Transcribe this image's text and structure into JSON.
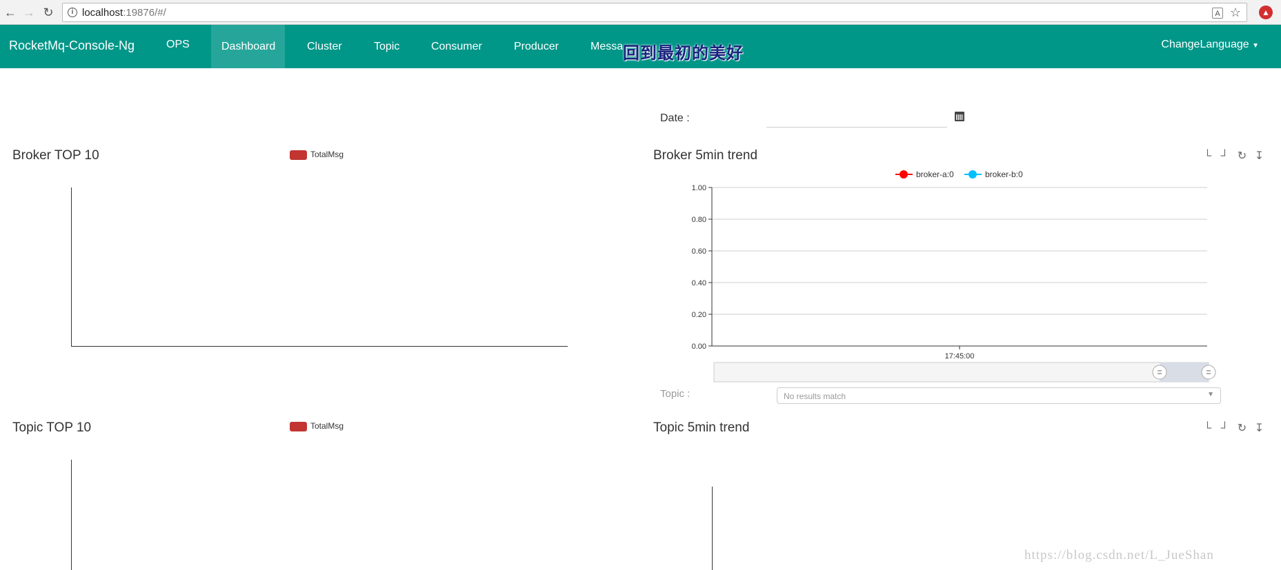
{
  "browser": {
    "url_host": "localhost",
    "url_rest": ":19876/#/"
  },
  "navbar": {
    "brand": "RocketMq-Console-Ng",
    "items": [
      {
        "label": "OPS"
      },
      {
        "label": "Dashboard"
      },
      {
        "label": "Cluster"
      },
      {
        "label": "Topic"
      },
      {
        "label": "Consumer"
      },
      {
        "label": "Producer"
      },
      {
        "label": "Messa"
      }
    ],
    "overlay_text": "回到最初的美好",
    "change_language": "ChangeLanguage"
  },
  "date": {
    "label": "Date :",
    "value": ""
  },
  "broker_top10": {
    "title": "Broker TOP 10",
    "legend": "TotalMsg"
  },
  "broker_trend": {
    "title": "Broker 5min trend",
    "legend": [
      {
        "name": "broker-a:0",
        "color": "#ff0000"
      },
      {
        "name": "broker-b:0",
        "color": "#00bfff"
      }
    ]
  },
  "topic_filter": {
    "label": "Topic :",
    "placeholder": "No results match"
  },
  "topic_top10": {
    "title": "Topic TOP 10",
    "legend": "TotalMsg"
  },
  "topic_trend": {
    "title": "Topic 5min trend"
  },
  "toolbox_icons": [
    "zoom-icon",
    "zoom-reset-icon",
    "restore-icon",
    "save-image-icon"
  ],
  "watermark": "https://blog.csdn.net/L_JueShan",
  "chart_data": [
    {
      "type": "line",
      "title": "Broker 5min trend",
      "x": [
        "17:45:00"
      ],
      "series": [
        {
          "name": "broker-a:0",
          "values": []
        },
        {
          "name": "broker-b:0",
          "values": []
        }
      ],
      "yticks": [
        "0.00",
        "0.20",
        "0.40",
        "0.60",
        "0.80",
        "1.00"
      ],
      "ylim": [
        0,
        1
      ],
      "grid": true,
      "legend": "top-center"
    }
  ]
}
